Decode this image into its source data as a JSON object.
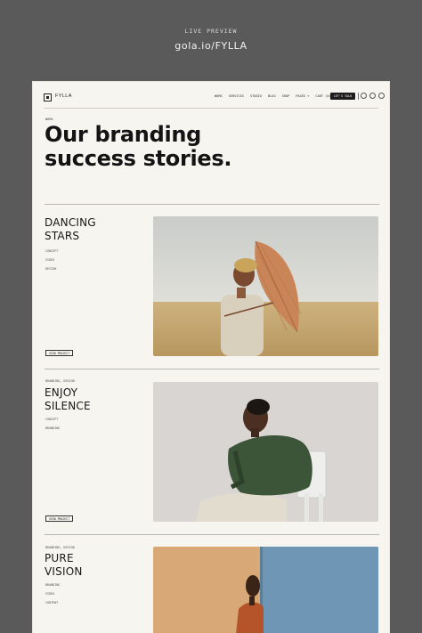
{
  "preview": {
    "label": "LIVE PREVIEW",
    "url": "gola.io/FYLLA"
  },
  "nav": {
    "logo_text": "FYLLA",
    "links": [
      "WORK",
      "SERVICES",
      "STUDIO",
      "BLOG",
      "SHOP",
      "PAGES ▾",
      "CART (0)"
    ],
    "cta_label": "LET'S TALK"
  },
  "hero": {
    "breadcrumb": "WORK",
    "title_line1": "Our branding",
    "title_line2": "success stories."
  },
  "projects": [
    {
      "tags": "",
      "title_line1": "DANCING",
      "title_line2": "STARS",
      "meta": [
        "CONCEPT",
        "VIDEO",
        "DESIGN"
      ],
      "button_label": "VIEW PROJECT",
      "image_subject": "woman-with-umbrella-in-field"
    },
    {
      "tags": "BRANDING, DESIGN",
      "title_line1": "ENJOY",
      "title_line2": "SILENCE",
      "meta": [
        "CONCEPT",
        "BRANDING"
      ],
      "button_label": "VIEW PROJECT",
      "image_subject": "man-seated-on-chair"
    },
    {
      "tags": "BRANDING, DESIGN",
      "title_line1": "PURE",
      "title_line2": "VISION",
      "meta": [
        "BRANDING",
        "VIDEO",
        "CONTENT"
      ],
      "button_label": "",
      "image_subject": "portrait-against-blue-panel"
    }
  ],
  "colors": {
    "page_bg": "#5a5a5a",
    "site_bg": "#f7f5ef",
    "text": "#141414",
    "accent_umbrella": "#c98558"
  }
}
